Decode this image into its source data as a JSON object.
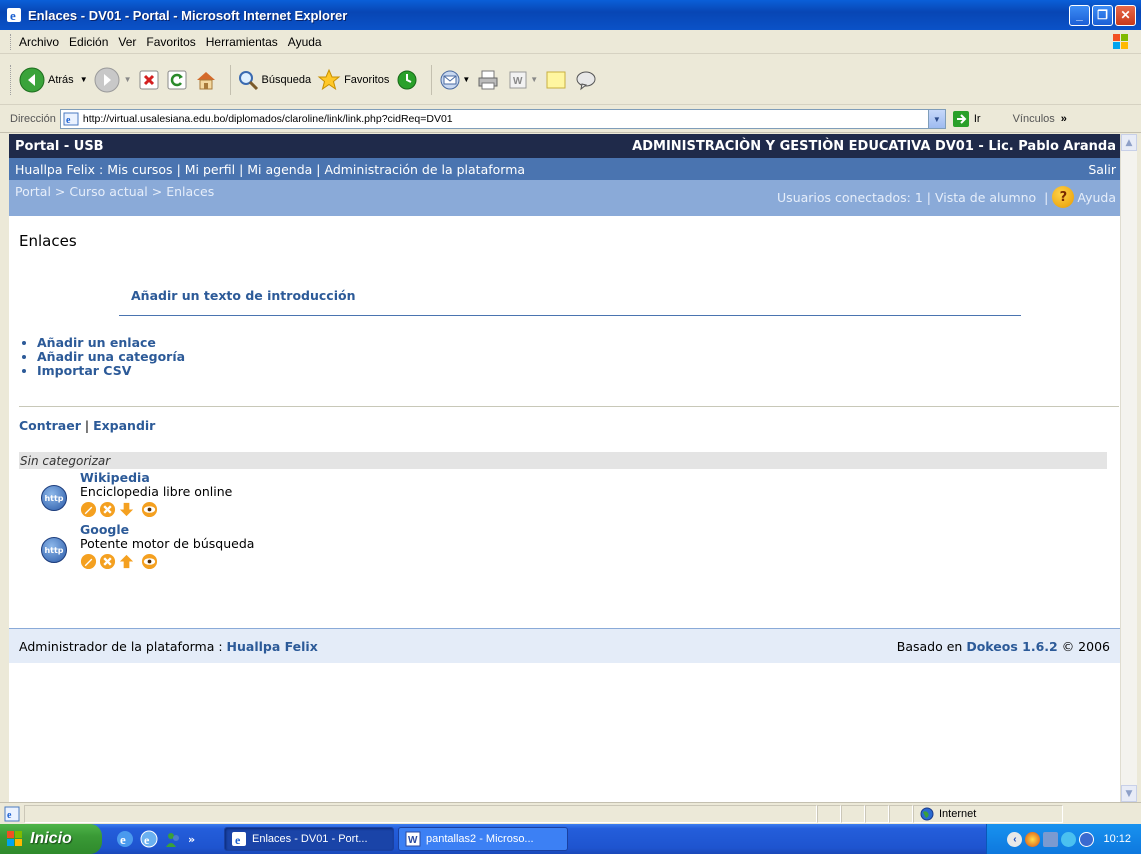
{
  "window": {
    "title": "Enlaces - DV01 - Portal - Microsoft Internet Explorer"
  },
  "menu": [
    "Archivo",
    "Edición",
    "Ver",
    "Favoritos",
    "Herramientas",
    "Ayuda"
  ],
  "toolbar": {
    "back_label": "Atrás",
    "search_label": "Búsqueda",
    "favorites_label": "Favoritos"
  },
  "address": {
    "label": "Dirección",
    "url": "http://virtual.usalesiana.edu.bo/diplomados/claroline/link/link.php?cidReq=DV01",
    "go_label": "Ir",
    "links_label": "Vínculos"
  },
  "portal": {
    "site_name": "Portal - USB",
    "course_title": "ADMINISTRACIÒN Y GESTIÒN EDUCATIVA DV01 - Lic. Pablo Aranda",
    "nav_links": [
      "Huallpa Felix",
      "Mis cursos",
      "Mi perfil",
      "Mi agenda",
      "Administración de la plataforma"
    ],
    "logout_label": "Salir",
    "breadcrumb": [
      "Portal",
      "Curso actual",
      "Enlaces"
    ],
    "users_connected": "Usuarios conectados: 1",
    "student_view": "Vista de alumno",
    "help_label": "Ayuda"
  },
  "page": {
    "title": "Enlaces",
    "intro_link": "Añadir un texto de introducción",
    "actions": [
      "Añadir un enlace",
      "Añadir una categoría",
      "Importar CSV"
    ],
    "collapse_label": "Contraer",
    "expand_label": "Expandir",
    "category_name": "Sin categorizar",
    "links": [
      {
        "title": "Wikipedia",
        "description": "Enciclopedia libre online",
        "move": "down"
      },
      {
        "title": "Google",
        "description": "Potente motor de búsqueda",
        "move": "up"
      }
    ]
  },
  "footer": {
    "admin_prefix": "Administrador de la plataforma :",
    "admin_name": "Huallpa Felix",
    "powered_prefix": "Basado en",
    "powered_link": "Dokeos 1.6.2",
    "powered_suffix": "© 2006"
  },
  "statusbar": {
    "zone": "Internet"
  },
  "taskbar": {
    "start_label": "Inicio",
    "tasks": [
      "Enlaces - DV01 - Port...",
      "pantallas2 - Microso..."
    ],
    "clock": "10:12"
  },
  "colors": {
    "portal_dark": "#1f2a4a",
    "portal_mid": "#4a74b0",
    "portal_light": "#8aaad8",
    "link_blue": "#2c5a98"
  }
}
